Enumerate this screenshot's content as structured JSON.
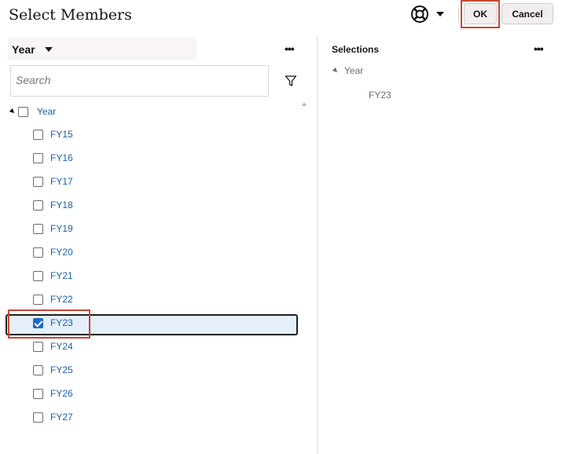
{
  "dialog": {
    "title": "Select Members",
    "ok_label": "OK",
    "cancel_label": "Cancel",
    "help_icon": "lifebuoy-icon"
  },
  "members_panel": {
    "dimension": "Year",
    "more_label": "•••",
    "search_placeholder": "Search",
    "root": {
      "label": "Year",
      "checked": false,
      "expanded": true
    },
    "members": [
      {
        "label": "FY15",
        "checked": false
      },
      {
        "label": "FY16",
        "checked": false
      },
      {
        "label": "FY17",
        "checked": false
      },
      {
        "label": "FY18",
        "checked": false
      },
      {
        "label": "FY19",
        "checked": false
      },
      {
        "label": "FY20",
        "checked": false
      },
      {
        "label": "FY21",
        "checked": false
      },
      {
        "label": "FY22",
        "checked": false
      },
      {
        "label": "FY23",
        "checked": true
      },
      {
        "label": "FY24",
        "checked": false
      },
      {
        "label": "FY25",
        "checked": false
      },
      {
        "label": "FY26",
        "checked": false
      },
      {
        "label": "FY27",
        "checked": false
      }
    ]
  },
  "selections_panel": {
    "title": "Selections",
    "more_label": "•••",
    "group": "Year",
    "items": [
      "FY23"
    ]
  },
  "colors": {
    "link": "#1b5fa8",
    "checkbox_checked": "#1b6bc5",
    "selected_row": "#e4eff8",
    "highlight": "#c74634"
  }
}
